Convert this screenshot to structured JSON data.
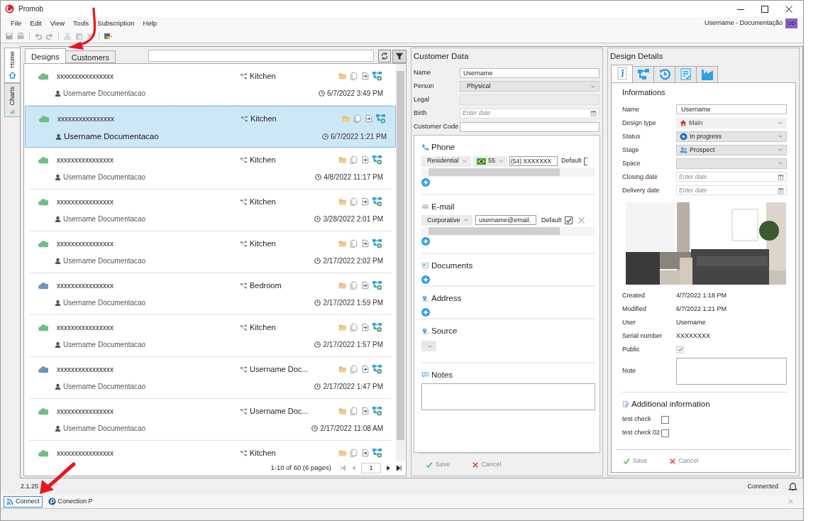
{
  "window": {
    "title": "Promob"
  },
  "menu": [
    "File",
    "Edit",
    "View",
    "Tools",
    "Subscription",
    "Help"
  ],
  "account": {
    "label": "Username - Documentação",
    "initials": "UD"
  },
  "side_tabs": [
    {
      "label": "Home",
      "kind": "home",
      "selected": true
    },
    {
      "label": "Charts",
      "kind": "charts",
      "selected": false
    }
  ],
  "designs": {
    "tabs": [
      {
        "label": "Designs",
        "selected": true
      },
      {
        "label": "Customers",
        "selected": false
      }
    ],
    "rows": [
      {
        "name": "xxxxxxxxxxxxxxxx",
        "color": "#6dbf83",
        "type": "Kitchen",
        "user": "Username Documentacao",
        "date": "6/7/2022 3:49 PM",
        "selected": false
      },
      {
        "name": "xxxxxxxxxxxxxxxx",
        "color": "#6dbf83",
        "type": "Kitchen",
        "user": "Username Documentacao",
        "date": "6/7/2022 1:21 PM",
        "selected": true
      },
      {
        "name": "xxxxxxxxxxxxxxxx",
        "color": "#6dbf83",
        "type": "Kitchen",
        "user": "Username Documentacao",
        "date": "4/8/2022 11:17 PM",
        "selected": false
      },
      {
        "name": "xxxxxxxxxxxxxxxx",
        "color": "#6dbf83",
        "type": "Kitchen",
        "user": "Username Documentacao",
        "date": "3/28/2022 2:01 PM",
        "selected": false
      },
      {
        "name": "xxxxxxxxxxxxxxxx",
        "color": "#6dbf83",
        "type": "Kitchen",
        "user": "Username Documentacao",
        "date": "2/17/2022 2:02 PM",
        "selected": false
      },
      {
        "name": "xxxxxxxxxxxxxxxx",
        "color": "#6a96bd",
        "type": "Bedroom",
        "user": "Username Documentacao",
        "date": "2/17/2022 1:59 PM",
        "selected": false
      },
      {
        "name": "xxxxxxxxxxxxxxxx",
        "color": "#6dbf83",
        "type": "Kitchen",
        "user": "Username Documentacao",
        "date": "2/17/2022 1:57 PM",
        "selected": false
      },
      {
        "name": "xxxxxxxxxxxxxxxx",
        "color": "#6a96bd",
        "type": "Username Doc...",
        "user": "Username Documentacao",
        "date": "2/17/2022 1:47 PM",
        "selected": false
      },
      {
        "name": "xxxxxxxxxxxxxxxx",
        "color": "#6dbf83",
        "type": "Username Doc...",
        "user": "Username Documentacao",
        "date": "2/17/2022 11:08 AM",
        "selected": false
      },
      {
        "name": "xxxxxxxxxxxxxxxx",
        "color": "#6dbf83",
        "type": "Kitchen",
        "selected": false
      }
    ],
    "pagination": {
      "summary": "1-10 of 60 (6 pages)",
      "page": "1"
    }
  },
  "customer_data": {
    "title": "Customer Data",
    "fields": [
      {
        "label": "Name",
        "kind": "text",
        "value": "Username"
      },
      {
        "label": "Person",
        "kind": "select",
        "value": "Physical"
      },
      {
        "label": "Legal",
        "kind": "disabled"
      },
      {
        "label": "Birth",
        "kind": "date",
        "placeholder": "Enter date"
      },
      {
        "label": "Customer Code",
        "kind": "text"
      }
    ],
    "phone": {
      "title": "Phone",
      "type": "Residential",
      "country_code": "55",
      "number": "(54) XXXXXXX",
      "default_label": "Default",
      "default_checked": false
    },
    "email": {
      "title": "E-mail",
      "type": "Corporative",
      "address": "username@email.",
      "default_label": "Default",
      "default_checked": true
    },
    "sections": [
      {
        "title": "Documents",
        "kind": "documents"
      },
      {
        "title": "Address",
        "kind": "address"
      },
      {
        "title": "Source",
        "kind": "source"
      }
    ],
    "notes": {
      "title": "Notes"
    },
    "buttons": [
      {
        "label": "Save",
        "kind": "save",
        "disabled": true
      },
      {
        "label": "Cancel",
        "kind": "cancel",
        "disabled": true
      }
    ]
  },
  "design_details": {
    "title": "Design Details",
    "tabs": [
      {
        "kind": "info",
        "selected": true
      },
      {
        "kind": "tree",
        "selected": false
      },
      {
        "kind": "history",
        "selected": false
      },
      {
        "kind": "checklist",
        "selected": false
      },
      {
        "kind": "factory",
        "selected": false
      }
    ],
    "section_title": "Informations",
    "fields": [
      {
        "label": "Name",
        "kind": "text",
        "value": "Username"
      },
      {
        "label": "Design type",
        "kind": "select",
        "value": "Main",
        "disabled": true
      },
      {
        "label": "Status",
        "kind": "select",
        "value": "In progress",
        "disabled": false
      },
      {
        "label": "Stage",
        "kind": "select",
        "value": "Prospect",
        "disabled": false
      },
      {
        "label": "Space",
        "kind": "select",
        "disabled": false
      },
      {
        "label": "Closing date",
        "kind": "date",
        "placeholder": "Enter date"
      },
      {
        "label": "Delivery date",
        "kind": "date",
        "placeholder": "Enter date"
      }
    ],
    "meta": [
      {
        "label": "Created",
        "kind": "text",
        "value": "4/7/2022 1:18 PM"
      },
      {
        "label": "Modified",
        "kind": "text",
        "value": "6/7/2022 1:21 PM"
      },
      {
        "label": "User",
        "kind": "text",
        "value": "Username"
      },
      {
        "label": "Serial number",
        "kind": "text",
        "value": "XXXXXXXX"
      },
      {
        "label": "Public",
        "kind": "checkbox",
        "checked": true,
        "disabled": true
      },
      {
        "label": "Note",
        "kind": "textarea"
      }
    ],
    "additional": {
      "title": "Additional information",
      "checks": [
        {
          "label": "test check",
          "checked": false
        },
        {
          "label": "test check 02",
          "checked": false
        }
      ]
    },
    "buttons": [
      {
        "label": "Save",
        "kind": "save",
        "disabled": true
      },
      {
        "label": "Cancel",
        "kind": "cancel",
        "disabled": true
      }
    ]
  },
  "status": {
    "version": "2.1.25",
    "connection": "Connected"
  },
  "taskbar": [
    {
      "label": "Connect",
      "kind": "connect",
      "selected": true
    },
    {
      "label": "Conection P",
      "kind": "promob",
      "selected": false
    }
  ]
}
